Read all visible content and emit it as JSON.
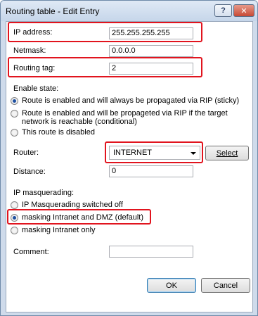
{
  "window": {
    "title": "Routing table - Edit Entry",
    "help_label": "?",
    "close_label": "✕"
  },
  "ip_address": {
    "label": "IP address:",
    "value": "255.255.255.255"
  },
  "netmask": {
    "label": "Netmask:",
    "value": "0.0.0.0"
  },
  "routing_tag": {
    "label": "Routing tag:",
    "value": "2"
  },
  "enable_state": {
    "label": "Enable state:",
    "options": [
      {
        "label": "Route is enabled and will always be propagated via RIP (sticky)",
        "checked": true
      },
      {
        "label": "Route is enabled and will be propageted via RIP if the target network is reachable (conditional)",
        "checked": false
      },
      {
        "label": "This route is disabled",
        "checked": false
      }
    ]
  },
  "router": {
    "label": "Router:",
    "value": "INTERNET",
    "select_button": "Select"
  },
  "distance": {
    "label": "Distance:",
    "value": "0"
  },
  "masquerading": {
    "label": "IP masquerading:",
    "options": [
      {
        "label": "IP Masquerading switched off",
        "checked": false
      },
      {
        "label": "masking Intranet and DMZ (default)",
        "checked": true
      },
      {
        "label": "masking Intranet only",
        "checked": false
      }
    ]
  },
  "comment": {
    "label": "Comment:",
    "value": ""
  },
  "buttons": {
    "ok": "OK",
    "cancel": "Cancel"
  },
  "colors": {
    "highlight": "#e1141e",
    "title_bg": "#c6d6ea",
    "close_bg": "#c74a35"
  },
  "icons": {
    "help": "question-icon",
    "close": "close-icon",
    "dropdown": "chevron-down-icon"
  }
}
